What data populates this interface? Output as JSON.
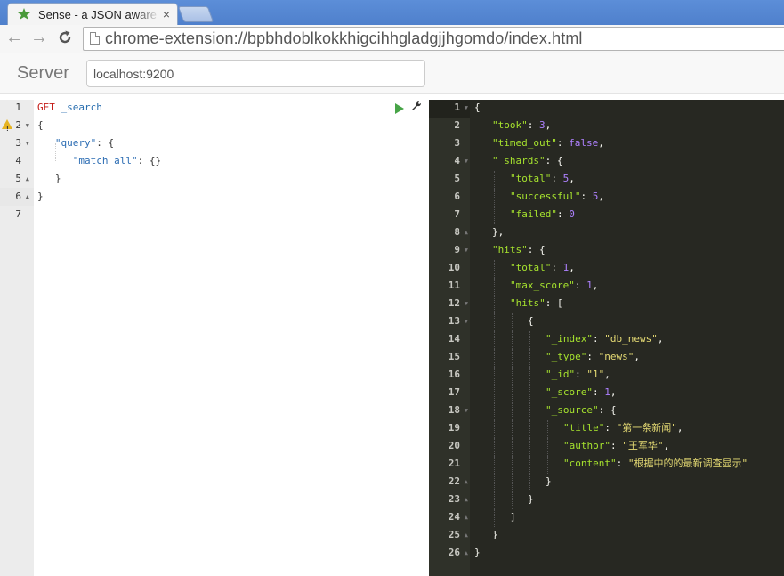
{
  "browser": {
    "tab_title": "Sense - a JSON aware interface to ElasticSearch",
    "tab_close": "×",
    "url": "chrome-extension://bpbhdoblkokkhigcihhgladgjjhgomdo/index.html",
    "back": "←",
    "forward": "→",
    "reload": "C"
  },
  "header": {
    "brand": "Server",
    "server_value": "localhost:9200"
  },
  "request": {
    "lines": [
      {
        "n": "1",
        "fold": ""
      },
      {
        "n": "2",
        "fold": "▼"
      },
      {
        "n": "3",
        "fold": "▼"
      },
      {
        "n": "4",
        "fold": ""
      },
      {
        "n": "5",
        "fold": "▲"
      },
      {
        "n": "6",
        "fold": "▲"
      },
      {
        "n": "7",
        "fold": ""
      }
    ],
    "method": "GET",
    "endpoint": "_search",
    "open_brace": "{",
    "query_key": "\"query\"",
    "match_all_key": "\"match_all\"",
    "empty_obj": "{}",
    "close_brace": "}",
    "close_final": "}"
  },
  "response": {
    "took": "3",
    "timed_out": "false",
    "shards_total": "5",
    "shards_successful": "5",
    "shards_failed": "0",
    "hits_total": "1",
    "max_score": "1",
    "index": "\"db_news\"",
    "type": "\"news\"",
    "id": "\"1\"",
    "score": "1",
    "title": "\"第一条新闻\"",
    "author": "\"王军华\"",
    "content": "\"根据中的的最新调查显示\""
  },
  "colors": {
    "run_icon": "#47a447",
    "output_bg": "#272822",
    "key": "#a6e22e",
    "string": "#e6db74",
    "number": "#ae81ff"
  }
}
